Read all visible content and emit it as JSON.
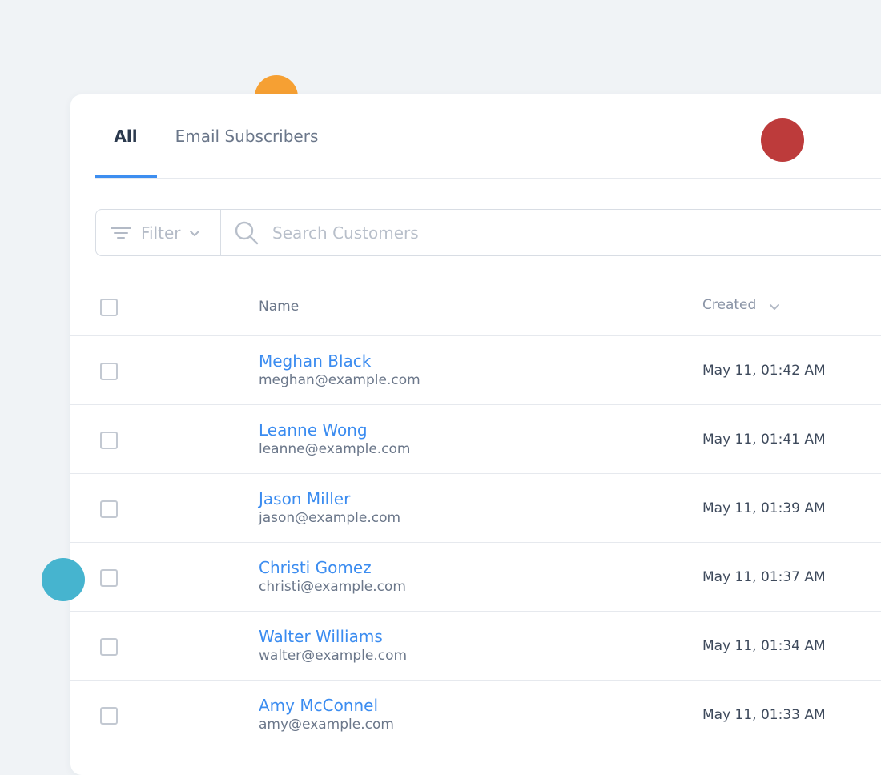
{
  "tabs": [
    {
      "label": "All",
      "active": true
    },
    {
      "label": "Email Subscribers",
      "active": false
    }
  ],
  "toolbar": {
    "filter_label": "Filter",
    "search_placeholder": "Search Customers"
  },
  "table": {
    "headers": {
      "name": "Name",
      "created": "Created"
    },
    "rows": [
      {
        "name": "Meghan Black",
        "email": "meghan@example.com",
        "created": "May 11, 01:42 AM"
      },
      {
        "name": "Leanne Wong",
        "email": "leanne@example.com",
        "created": "May 11, 01:41 AM"
      },
      {
        "name": "Jason Miller",
        "email": "jason@example.com",
        "created": "May 11, 01:39 AM"
      },
      {
        "name": "Christi Gomez",
        "email": "christi@example.com",
        "created": "May 11, 01:37 AM"
      },
      {
        "name": "Walter Williams",
        "email": "walter@example.com",
        "created": "May 11, 01:34 AM"
      },
      {
        "name": "Amy McConnel",
        "email": "amy@example.com",
        "created": "May 11, 01:33 AM"
      }
    ]
  },
  "colors": {
    "accent": "#3d8ef0",
    "link": "#3b8cf0",
    "dot_orange": "#f6a033",
    "dot_red": "#bd3b3b",
    "dot_teal": "#46b4cf"
  },
  "icons": {
    "filter": "filter-lines-icon",
    "dropdown": "chevron-down-icon",
    "search": "search-icon",
    "sort": "sort-chevron-icon"
  }
}
